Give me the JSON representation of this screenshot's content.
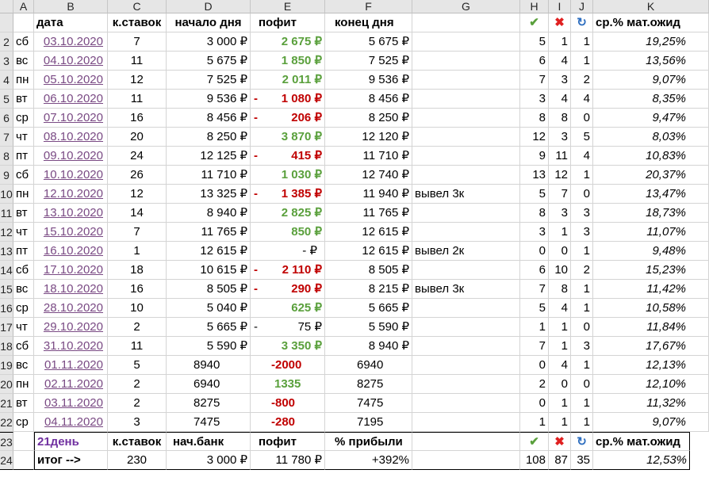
{
  "columns": [
    "A",
    "B",
    "C",
    "D",
    "E",
    "F",
    "G",
    "H",
    "I",
    "J",
    "K"
  ],
  "header": {
    "date": "дата",
    "bets": "к.ставок",
    "start": "начало дня",
    "profit": "пофит",
    "end": "конец дня",
    "check": "✔",
    "cross": "✖",
    "refresh": "↻",
    "ev": "ср.% мат.ожид"
  },
  "rows": [
    {
      "rn": "2",
      "day": "сб",
      "date": "03.10.2020",
      "bets": "7",
      "start": "3 000 ₽",
      "neg": false,
      "profit": "2 675 ₽",
      "end": "5 675 ₽",
      "note": "",
      "h": "5",
      "i": "1",
      "j": "1",
      "k": "19,25%"
    },
    {
      "rn": "3",
      "day": "вс",
      "date": "04.10.2020",
      "bets": "11",
      "start": "5 675 ₽",
      "neg": false,
      "profit": "1 850 ₽",
      "end": "7 525 ₽",
      "note": "",
      "h": "6",
      "i": "4",
      "j": "1",
      "k": "13,56%"
    },
    {
      "rn": "4",
      "day": "пн",
      "date": "05.10.2020",
      "bets": "12",
      "start": "7 525 ₽",
      "neg": false,
      "profit": "2 011 ₽",
      "end": "9 536 ₽",
      "note": "",
      "h": "7",
      "i": "3",
      "j": "2",
      "k": "9,07%"
    },
    {
      "rn": "5",
      "day": "вт",
      "date": "06.10.2020",
      "bets": "11",
      "start": "9 536 ₽",
      "neg": true,
      "profit": "1 080 ₽",
      "end": "8 456 ₽",
      "note": "",
      "h": "3",
      "i": "4",
      "j": "4",
      "k": "8,35%"
    },
    {
      "rn": "6",
      "day": "ср",
      "date": "07.10.2020",
      "bets": "16",
      "start": "8 456 ₽",
      "neg": true,
      "profit": "206 ₽",
      "end": "8 250 ₽",
      "note": "",
      "h": "8",
      "i": "8",
      "j": "0",
      "k": "9,47%"
    },
    {
      "rn": "7",
      "day": "чт",
      "date": "08.10.2020",
      "bets": "20",
      "start": "8 250 ₽",
      "neg": false,
      "profit": "3 870 ₽",
      "end": "12 120 ₽",
      "note": "",
      "h": "12",
      "i": "3",
      "j": "5",
      "k": "8,03%"
    },
    {
      "rn": "8",
      "day": "пт",
      "date": "09.10.2020",
      "bets": "24",
      "start": "12 125 ₽",
      "neg": true,
      "profit": "415 ₽",
      "end": "11 710 ₽",
      "note": "",
      "h": "9",
      "i": "11",
      "j": "4",
      "k": "10,83%"
    },
    {
      "rn": "9",
      "day": "сб",
      "date": "10.10.2020",
      "bets": "26",
      "start": "11 710 ₽",
      "neg": false,
      "profit": "1 030 ₽",
      "end": "12 740 ₽",
      "note": "",
      "h": "13",
      "i": "12",
      "j": "1",
      "k": "20,37%"
    },
    {
      "rn": "10",
      "day": "пн",
      "date": "12.10.2020",
      "bets": "12",
      "start": "13 325 ₽",
      "neg": true,
      "profit": "1 385 ₽",
      "end": "11 940 ₽",
      "note": "вывел 3к",
      "h": "5",
      "i": "7",
      "j": "0",
      "k": "13,47%"
    },
    {
      "rn": "11",
      "day": "вт",
      "date": "13.10.2020",
      "bets": "14",
      "start": "8 940 ₽",
      "neg": false,
      "profit": "2 825 ₽",
      "end": "11 765 ₽",
      "note": "",
      "h": "8",
      "i": "3",
      "j": "3",
      "k": "18,73%"
    },
    {
      "rn": "12",
      "day": "чт",
      "date": "15.10.2020",
      "bets": "7",
      "start": "11 765 ₽",
      "neg": false,
      "profit": "850 ₽",
      "end": "12 615 ₽",
      "note": "",
      "h": "3",
      "i": "1",
      "j": "3",
      "k": "11,07%"
    },
    {
      "rn": "13",
      "day": "пт",
      "date": "16.10.2020",
      "bets": "1",
      "start": "12 615 ₽",
      "neg": false,
      "profit": "-    ₽",
      "end": "12 615 ₽",
      "note": "вывел 2к",
      "h": "0",
      "i": "0",
      "j": "1",
      "k": "9,48%",
      "zero": true
    },
    {
      "rn": "14",
      "day": "сб",
      "date": "17.10.2020",
      "bets": "18",
      "start": "10 615 ₽",
      "neg": true,
      "profit": "2 110 ₽",
      "end": "8 505 ₽",
      "note": "",
      "h": "6",
      "i": "10",
      "j": "2",
      "k": "15,23%"
    },
    {
      "rn": "15",
      "day": "вс",
      "date": "18.10.2020",
      "bets": "16",
      "start": "8 505 ₽",
      "neg": true,
      "profit": "290 ₽",
      "end": "8 215 ₽",
      "note": "вывел 3к",
      "h": "7",
      "i": "8",
      "j": "1",
      "k": "11,42%"
    },
    {
      "rn": "16",
      "day": "ср",
      "date": "28.10.2020",
      "bets": "10",
      "start": "5 040 ₽",
      "neg": false,
      "profit": "625 ₽",
      "end": "5 665 ₽",
      "note": "",
      "h": "5",
      "i": "4",
      "j": "1",
      "k": "10,58%"
    },
    {
      "rn": "17",
      "day": "чт",
      "date": "29.10.2020",
      "bets": "2",
      "start": "5 665 ₽",
      "neg": true,
      "plain": true,
      "profit": "75 ₽",
      "end": "5 590 ₽",
      "note": "",
      "h": "1",
      "i": "1",
      "j": "0",
      "k": "11,84%"
    },
    {
      "rn": "18",
      "day": "сб",
      "date": "31.10.2020",
      "bets": "11",
      "start": "5 590 ₽",
      "neg": false,
      "profit": "3 350 ₽",
      "end": "8 940 ₽",
      "note": "",
      "h": "7",
      "i": "1",
      "j": "3",
      "k": "17,67%"
    },
    {
      "rn": "19",
      "day": "вс",
      "date": "01.11.2020",
      "bets": "5",
      "start": "8940",
      "neg": true,
      "raw": true,
      "profit": "-2000",
      "end": "6940",
      "note": "",
      "h": "0",
      "i": "4",
      "j": "1",
      "k": "12,13%"
    },
    {
      "rn": "20",
      "day": "пн",
      "date": "02.11.2020",
      "bets": "2",
      "start": "6940",
      "neg": false,
      "raw": true,
      "profit": "1335",
      "end": "8275",
      "note": "",
      "h": "2",
      "i": "0",
      "j": "0",
      "k": "12,10%"
    },
    {
      "rn": "21",
      "day": "вт",
      "date": "03.11.2020",
      "bets": "2",
      "start": "8275",
      "neg": true,
      "raw": true,
      "profit": "-800",
      "end": "7475",
      "note": "",
      "h": "0",
      "i": "1",
      "j": "1",
      "k": "11,32%"
    },
    {
      "rn": "22",
      "day": "ср",
      "date": "04.11.2020",
      "bets": "3",
      "start": "7475",
      "neg": true,
      "raw": true,
      "profit": "-280",
      "end": "7195",
      "note": "",
      "h": "1",
      "i": "1",
      "j": "1",
      "k": "9,07%"
    }
  ],
  "summary_header": {
    "rn": "23",
    "days": "21день",
    "bets": "к.ставок",
    "bank": "нач.банк",
    "profit": "пофит",
    "percent": "% прибыли",
    "ev": "ср.% мат.ожид"
  },
  "summary": {
    "rn": "24",
    "label": "итог -->",
    "bets": "230",
    "bank": "3 000 ₽",
    "profit": "11 780 ₽",
    "percent": "+392%",
    "h": "108",
    "i": "87",
    "j": "35",
    "k": "12,53%"
  },
  "colors": {
    "positive": "#5aa03c",
    "negative": "#c00000",
    "date_link": "#7a4a84",
    "days_label": "#7030a0",
    "check": "#5aa03c",
    "cross": "#e02020",
    "refresh": "#2f6fc0"
  }
}
